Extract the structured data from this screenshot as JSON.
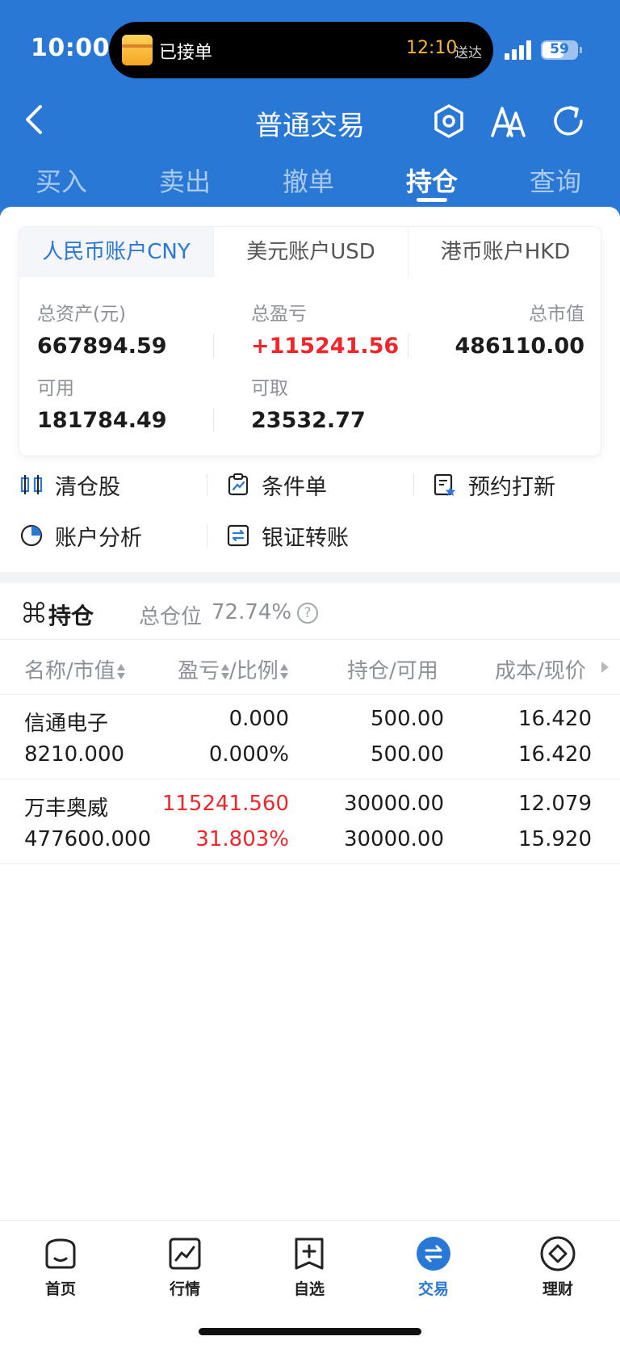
{
  "status_bar": {
    "time": "10:00",
    "island_label": "已接单",
    "island_time": "12:10",
    "island_sub": "送达",
    "battery": "59"
  },
  "nav": {
    "title": "普通交易",
    "back_icon": "chevron-left-icon",
    "icons": [
      "hexagon-settings-icon",
      "font-size-icon",
      "refresh-icon"
    ]
  },
  "tabs": [
    {
      "label": "买入"
    },
    {
      "label": "卖出"
    },
    {
      "label": "撤单"
    },
    {
      "label": "持仓",
      "active": true
    },
    {
      "label": "查询"
    }
  ],
  "account_tabs": [
    {
      "label": "人民币账户CNY",
      "active": true
    },
    {
      "label": "美元账户USD"
    },
    {
      "label": "港币账户HKD"
    }
  ],
  "account": {
    "total_assets_label": "总资产(元)",
    "total_assets": "667894.59",
    "total_pnl_label": "总盈亏",
    "total_pnl": "+115241.56",
    "market_value_label": "总市值",
    "market_value": "486110.00",
    "available_label": "可用",
    "available": "181784.49",
    "withdrawable_label": "可取",
    "withdrawable": "23532.77"
  },
  "actions": [
    {
      "label": "清仓股",
      "icon": "clear-position-icon"
    },
    {
      "label": "条件单",
      "icon": "conditional-order-icon"
    },
    {
      "label": "预约打新",
      "icon": "ipo-subscribe-icon"
    },
    {
      "label": "账户分析",
      "icon": "pie-chart-icon"
    },
    {
      "label": "银证转账",
      "icon": "transfer-icon"
    }
  ],
  "holdings": {
    "title": "持仓",
    "position_label": "总仓位",
    "position_value": "72.74%",
    "columns": [
      "名称/市值",
      "盈亏",
      "/比例",
      "持仓/可用",
      "成本/现价"
    ],
    "rows": [
      {
        "name": "信通电子",
        "market_value": "8210.000",
        "pnl": "0.000",
        "pnl_ratio": "0.000%",
        "position": "500.00",
        "available": "500.00",
        "cost": "16.420",
        "price": "16.420",
        "loss_gain": "flat"
      },
      {
        "name": "万丰奥威",
        "market_value": "477600.000",
        "pnl": "115241.560",
        "pnl_ratio": "31.803%",
        "position": "30000.00",
        "available": "30000.00",
        "cost": "12.079",
        "price": "15.920",
        "loss_gain": "gain"
      }
    ]
  },
  "bottom_nav": [
    {
      "label": "首页",
      "icon": "home-icon"
    },
    {
      "label": "行情",
      "icon": "market-chart-icon"
    },
    {
      "label": "自选",
      "icon": "watchlist-add-icon"
    },
    {
      "label": "交易",
      "icon": "trade-exchange-icon",
      "active": true
    },
    {
      "label": "理财",
      "icon": "wealth-diamond-icon"
    }
  ],
  "colors": {
    "brand_blue": "#2a78d6",
    "gain_red": "#f0262a",
    "muted_gray": "#8c9199"
  }
}
